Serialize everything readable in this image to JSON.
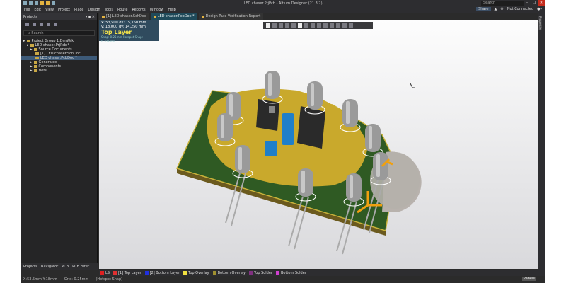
{
  "window": {
    "title": "LED chaser.PrjPcb - Altium Designer (21.3.2)",
    "search_placeholder": "Search",
    "min": "–",
    "max": "❐",
    "close": "✕"
  },
  "menu": [
    "File",
    "Edit",
    "View",
    "Project",
    "Place",
    "Design",
    "Tools",
    "Route",
    "Reports",
    "Window",
    "Help"
  ],
  "right_menu": {
    "share": "Share",
    "connection": "Not Connected"
  },
  "projects_panel": {
    "title": "Projects",
    "search_placeholder": "Search",
    "tree": [
      {
        "label": "Project Group 1.DsnWrk",
        "level": 0
      },
      {
        "label": "LED chaser.PrjPcb *",
        "level": 1
      },
      {
        "label": "Source Documents",
        "level": 2
      },
      {
        "label": "[1] LED chaser.SchDoc",
        "level": 3
      },
      {
        "label": "LED chaser.PcbDoc *",
        "level": 3,
        "selected": true
      },
      {
        "label": "Generated",
        "level": 2
      },
      {
        "label": "Components",
        "level": 2
      },
      {
        "label": "Nets",
        "level": 2
      }
    ],
    "tabs": [
      "Projects",
      "Navigator",
      "PCB",
      "PCB Filter"
    ]
  },
  "doc_tabs": [
    {
      "label": "[1] LED chaser.SchDoc",
      "active": false
    },
    {
      "label": "LED chaser.PcbDoc *",
      "active": true
    },
    {
      "label": "Design Rule Verification Report",
      "active": false
    }
  ],
  "hud": {
    "line1": "x: 53,500   dx: 15,750  mm",
    "line2": "y: 18,000   dy: 14,250  mm",
    "layer": "Top Layer",
    "snap": "Snap: 0.25mm Hotspot Snap: 0.203mm"
  },
  "right_panel": {
    "label": "Properties"
  },
  "layers": [
    {
      "label": "LS",
      "color": "#e02020"
    },
    {
      "label": "[1] Top Layer",
      "color": "#e03030"
    },
    {
      "label": "[2] Bottom Layer",
      "color": "#2030e0"
    },
    {
      "label": "Top Overlay",
      "color": "#f0e040"
    },
    {
      "label": "Bottom Overlay",
      "color": "#a09030"
    },
    {
      "label": "Top Solder",
      "color": "#803080"
    },
    {
      "label": "Bottom Solder",
      "color": "#d040d0"
    }
  ],
  "status": {
    "coords": "X:53.5mm Y:18mm",
    "grid": "Grid: 0.25mm",
    "snap": "(Hotspot Snap)",
    "panels": "Panels"
  }
}
